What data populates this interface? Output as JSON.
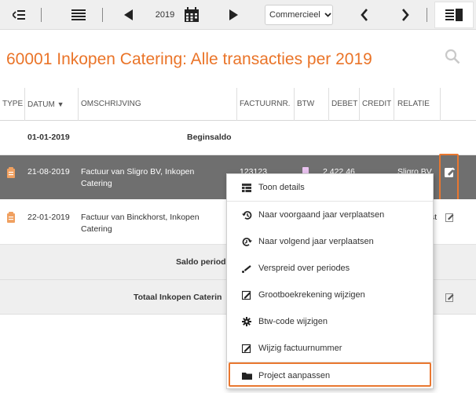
{
  "toolbar": {
    "year": "2019",
    "selected_view": "Commercieel"
  },
  "title": "60001 Inkopen Catering: Alle transacties per 2019",
  "columns": {
    "type": "TYPE",
    "datum": "DATUM",
    "omschrijving": "OMSCHRIJVING",
    "factuurnr": "FACTUURNR.",
    "btw": "BTW",
    "debet": "DEBET",
    "credit": "CREDIT",
    "relatie": "RELATIE"
  },
  "rows": {
    "begin": {
      "date": "01-01-2019",
      "label": "Beginsaldo"
    },
    "selected": {
      "date": "21-08-2019",
      "desc_line1": "Factuur van Sligro BV, Inkopen",
      "desc_line2": "Catering",
      "factuurnr": "123123",
      "debet": "2.422,46",
      "relatie": "Sligro BV"
    },
    "second": {
      "date": "22-01-2019",
      "desc_line1": "Factuur van Binckhorst, Inkopen",
      "desc_line2": "Catering",
      "relatie_partial": "st"
    },
    "saldo": "Saldo period",
    "totaal": "Totaal Inkopen Caterin"
  },
  "menu": {
    "items": [
      {
        "label": "Toon details",
        "icon": "table-icon"
      },
      {
        "label": "Naar voorgaand jaar verplaatsen",
        "icon": "history-back-icon"
      },
      {
        "label": "Naar volgend jaar verplaatsen",
        "icon": "history-forward-icon"
      },
      {
        "label": "Verspreid over periodes",
        "icon": "spread-icon"
      },
      {
        "label": "Grootboekrekening wijzigen",
        "icon": "edit-box-icon"
      },
      {
        "label": "Btw-code wijzigen",
        "icon": "gear-icon"
      },
      {
        "label": "Wijzig factuurnummer",
        "icon": "edit-box-icon"
      },
      {
        "label": "Project aanpassen",
        "icon": "folder-icon"
      }
    ]
  },
  "colors": {
    "accent": "#ea7428",
    "selected_row": "#6f6f6f",
    "toolbar_bg": "#efefef"
  }
}
